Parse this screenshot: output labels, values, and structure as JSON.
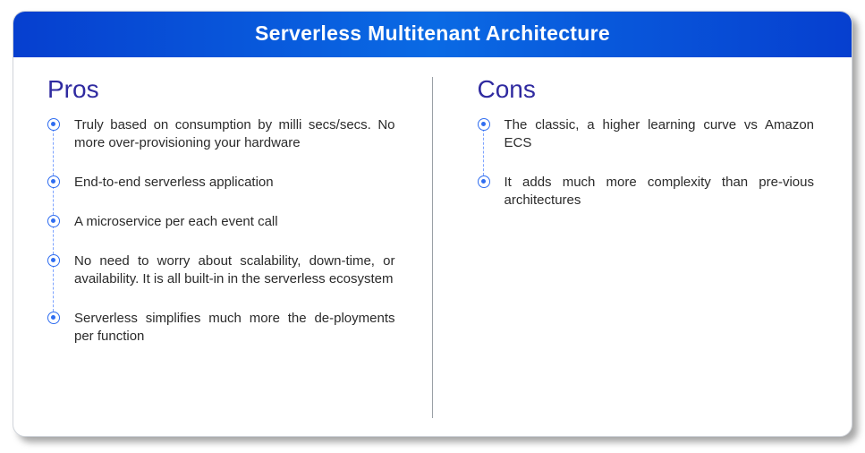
{
  "header": {
    "title": "Serverless Multitenant Architecture"
  },
  "colors": {
    "header_bg_from": "#063fcf",
    "header_bg_to": "#0a6ae4",
    "accent": "#2f6df0",
    "title": "#2f2aa0"
  },
  "pros": {
    "title": "Pros",
    "items": [
      "Truly based on consumption by milli secs/secs. No more over-provisioning your hardware",
      "End-to-end serverless application",
      "A microservice per each event call",
      "No need to worry about scalability, down-time, or availability. It is all built-in in the serverless ecosystem",
      "Serverless simplifies much more the de-ployments per function"
    ]
  },
  "cons": {
    "title": "Cons",
    "items": [
      "The classic, a higher learning curve vs Amazon ECS",
      "It adds much more complexity than pre-vious architectures"
    ]
  }
}
